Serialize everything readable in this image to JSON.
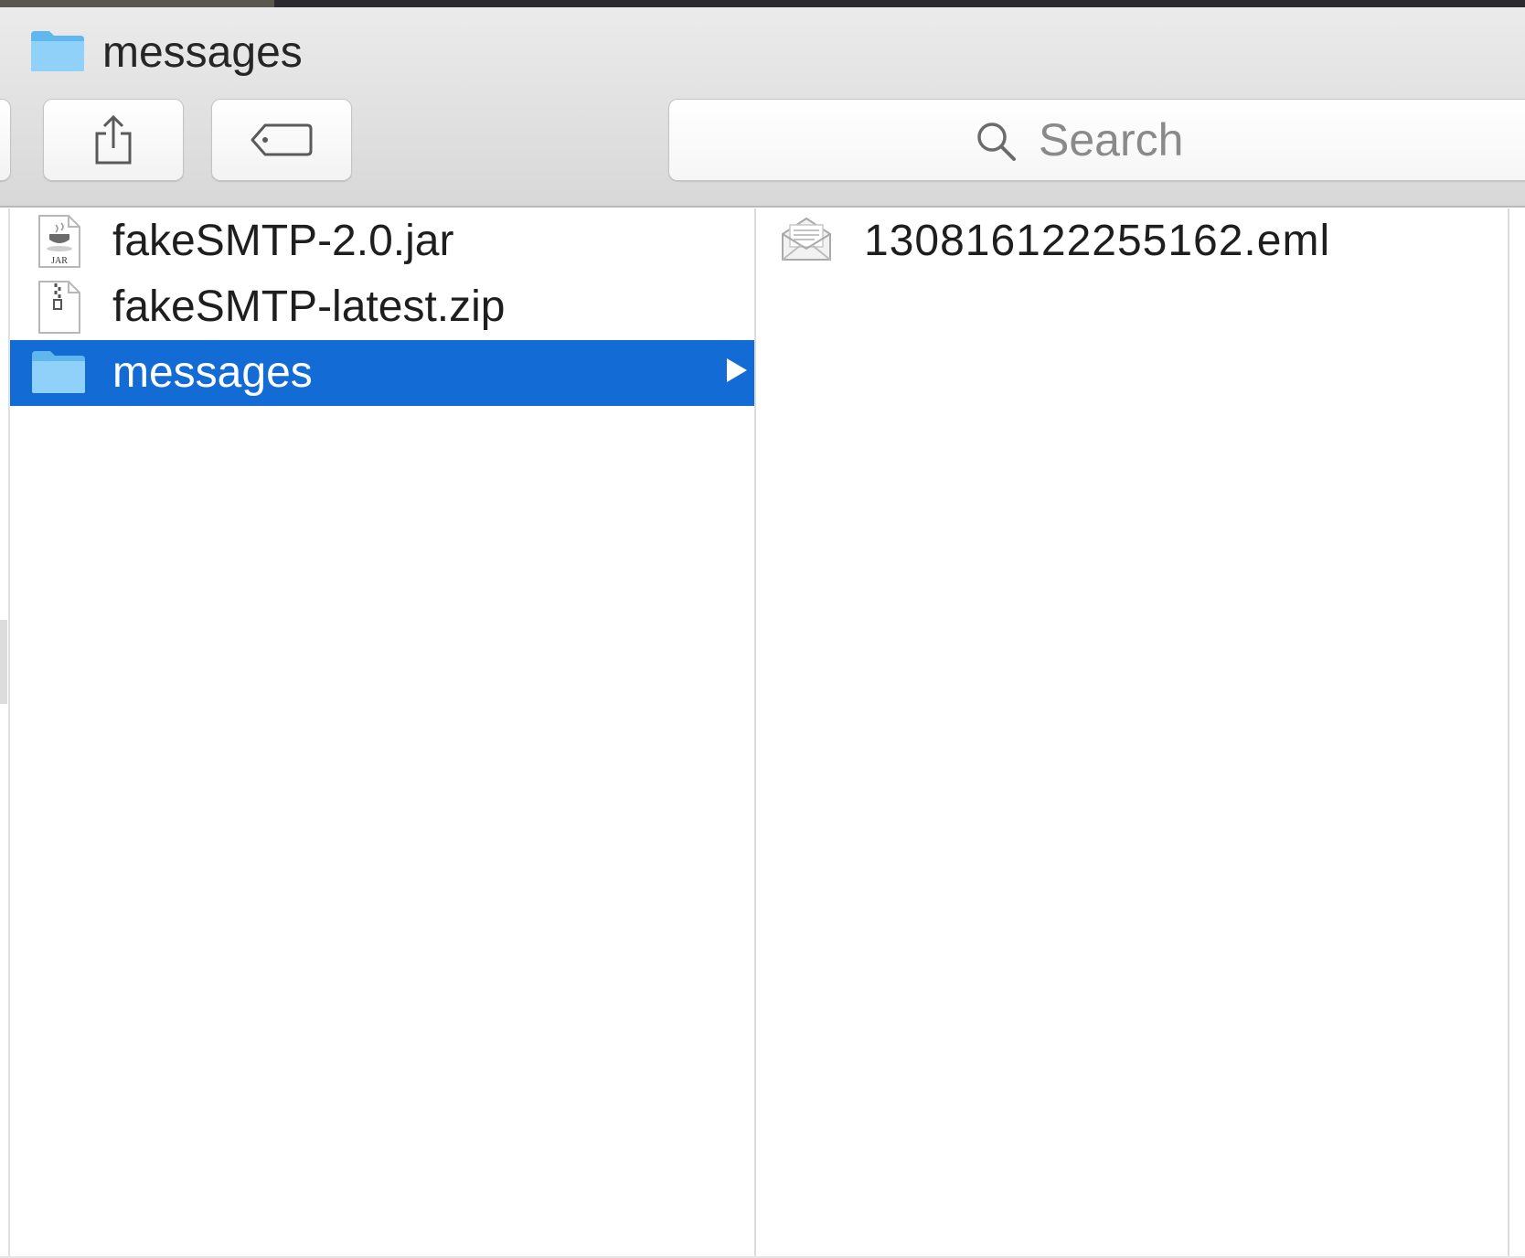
{
  "window": {
    "title": "messages",
    "title_icon": "folder-icon"
  },
  "toolbar": {
    "share_icon": "share-icon",
    "tag_icon": "tag-icon"
  },
  "search": {
    "placeholder": "Search",
    "icon": "search-icon"
  },
  "column1": {
    "items": [
      {
        "label": "fakeSMTP-2.0.jar",
        "icon": "jar-file-icon",
        "selected": false
      },
      {
        "label": "fakeSMTP-latest.zip",
        "icon": "zip-file-icon",
        "selected": false
      },
      {
        "label": "messages",
        "icon": "folder-icon",
        "selected": true
      }
    ]
  },
  "column2": {
    "items": [
      {
        "label": "130816122255162.eml",
        "icon": "email-file-icon",
        "selected": false
      }
    ]
  },
  "colors": {
    "selection": "#136bd5",
    "folder": "#6cc3f5",
    "toolbar": "#e3e2e3"
  }
}
